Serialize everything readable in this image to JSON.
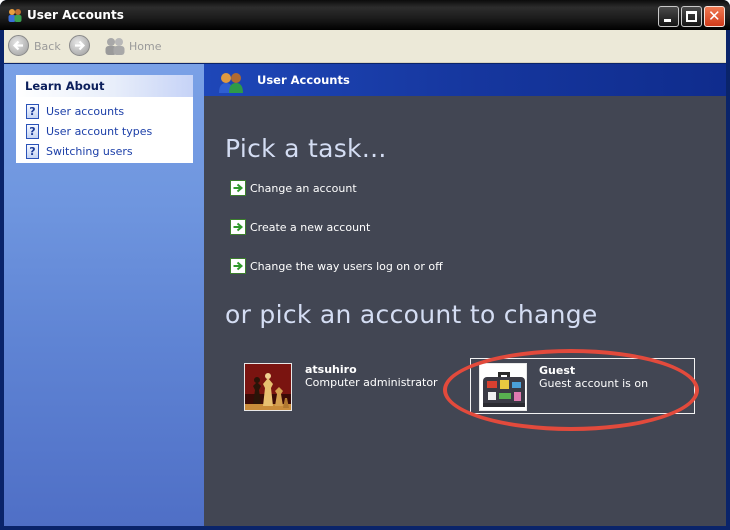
{
  "window": {
    "title": "User Accounts"
  },
  "toolbar": {
    "back_label": "Back",
    "home_label": "Home"
  },
  "left_pane": {
    "learn_about_title": "Learn About",
    "items": [
      {
        "label": "User accounts",
        "icon": "help-icon"
      },
      {
        "label": "User account types",
        "icon": "help-icon"
      },
      {
        "label": "Switching users",
        "icon": "help-icon"
      }
    ]
  },
  "right_pane": {
    "header_title": "User Accounts",
    "pick_task_heading": "Pick a task...",
    "tasks": [
      {
        "label": "Change an account"
      },
      {
        "label": "Create a new account"
      },
      {
        "label": "Change the way users log on or off"
      }
    ],
    "pick_account_heading": "or pick an account to change",
    "accounts": [
      {
        "name": "atsuhiro",
        "description": "Computer administrator",
        "picture": "chess-pieces"
      },
      {
        "name": "Guest",
        "description": "Guest account is on",
        "picture": "suitcase"
      }
    ]
  },
  "colors": {
    "title_bar": "#1c1c1c",
    "toolbar": "#ece9d8",
    "left_pane": "#6f96df",
    "right_pane": "#424653",
    "header": "#16379f",
    "heading_text": "#d4ddf3",
    "highlight_ring": "#e24a3c"
  }
}
